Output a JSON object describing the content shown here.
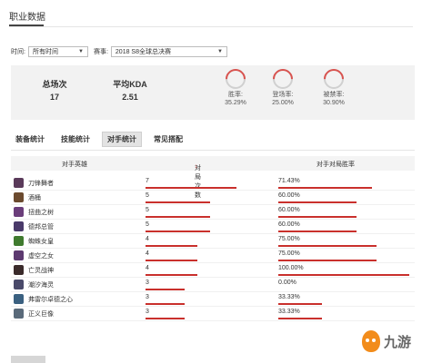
{
  "header": {
    "title": "职业数据"
  },
  "filters": {
    "time_label": "时间:",
    "time_value": "所有时间",
    "event_label": "赛事:",
    "event_value": "2018 S8全球总决赛"
  },
  "summary": {
    "games_label": "总场次",
    "games_value": "17",
    "kda_label": "平均KDA",
    "kda_value": "2.51",
    "win_label": "胜率:",
    "win_value": "35.29%",
    "win_fraction": 0.3529,
    "pick_label": "登场率:",
    "pick_value": "25.00%",
    "pick_fraction": 0.25,
    "ban_label": "被禁率:",
    "ban_value": "30.90%",
    "ban_fraction": 0.309,
    "accent": "#d9534f"
  },
  "tabs": [
    "装备统计",
    "技能统计",
    "对手统计",
    "常见搭配"
  ],
  "active_tab": 2,
  "table": {
    "col_hero": "对手英雄",
    "col_games": "对局次数",
    "col_rate": "对手对局胜率",
    "sort_arrow": "↓",
    "rows": [
      {
        "hero": "刀锋舞者",
        "games": "7",
        "rate": "71.43%",
        "games_num": 7,
        "rate_pct": 71.43,
        "avatar": "#5a3a5a"
      },
      {
        "hero": "酒桶",
        "games": "5",
        "rate": "60.00%",
        "games_num": 5,
        "rate_pct": 60.0,
        "avatar": "#6b4a2e"
      },
      {
        "hero": "扭曲之树",
        "games": "5",
        "rate": "60.00%",
        "games_num": 5,
        "rate_pct": 60.0,
        "avatar": "#6a3d7a"
      },
      {
        "hero": "德邦总管",
        "games": "5",
        "rate": "60.00%",
        "games_num": 5,
        "rate_pct": 60.0,
        "avatar": "#4a3a6a"
      },
      {
        "hero": "蜘蛛女皇",
        "games": "4",
        "rate": "75.00%",
        "games_num": 4,
        "rate_pct": 75.0,
        "avatar": "#3f7a2e"
      },
      {
        "hero": "虚空之女",
        "games": "4",
        "rate": "75.00%",
        "games_num": 4,
        "rate_pct": 75.0,
        "avatar": "#5d3a70"
      },
      {
        "hero": "亡灵战神",
        "games": "4",
        "rate": "100.00%",
        "games_num": 4,
        "rate_pct": 100.0,
        "avatar": "#3a2a2a"
      },
      {
        "hero": "潮汐海灵",
        "games": "3",
        "rate": "0.00%",
        "games_num": 3,
        "rate_pct": 0.0,
        "avatar": "#4a4a6a"
      },
      {
        "hero": "弗雷尔卓德之心",
        "games": "3",
        "rate": "33.33%",
        "games_num": 3,
        "rate_pct": 33.33,
        "avatar": "#3a6080"
      },
      {
        "hero": "正义巨像",
        "games": "3",
        "rate": "33.33%",
        "games_num": 3,
        "rate_pct": 33.33,
        "avatar": "#5a6a7a"
      }
    ]
  },
  "watermark": {
    "text": "九游",
    "logo_color": "#f28c1b"
  }
}
